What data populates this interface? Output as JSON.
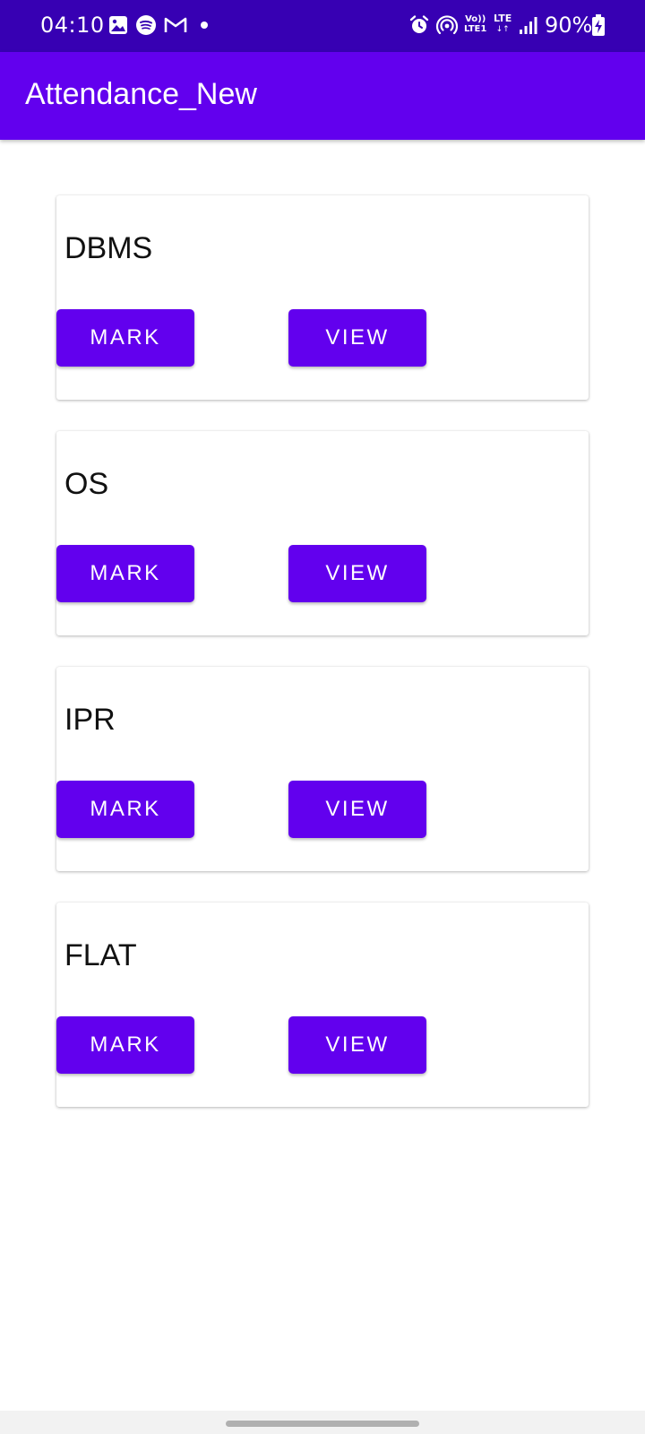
{
  "status_bar": {
    "time": "04:10",
    "volte_line1": "Vo))",
    "volte_line2": "LTE1",
    "lte_line1": "LTE",
    "lte_line2": "↓↑",
    "battery_percent": "90%",
    "icons": [
      "gallery-icon",
      "spotify-icon",
      "gmail-icon",
      "notification-dot",
      "alarm-icon",
      "hotspot-icon",
      "signal-icon",
      "battery-charging-icon"
    ]
  },
  "app_bar": {
    "title": "Attendance_New",
    "color": "#6200ee"
  },
  "subjects": [
    {
      "name": "DBMS",
      "mark_label": "MARK",
      "view_label": "VIEW"
    },
    {
      "name": "OS",
      "mark_label": "MARK",
      "view_label": "VIEW"
    },
    {
      "name": "IPR",
      "mark_label": "MARK",
      "view_label": "VIEW"
    },
    {
      "name": "FLAT",
      "mark_label": "MARK",
      "view_label": "VIEW"
    }
  ],
  "colors": {
    "status_bar": "#3700b3",
    "primary": "#6200ee",
    "background": "#ffffff"
  }
}
